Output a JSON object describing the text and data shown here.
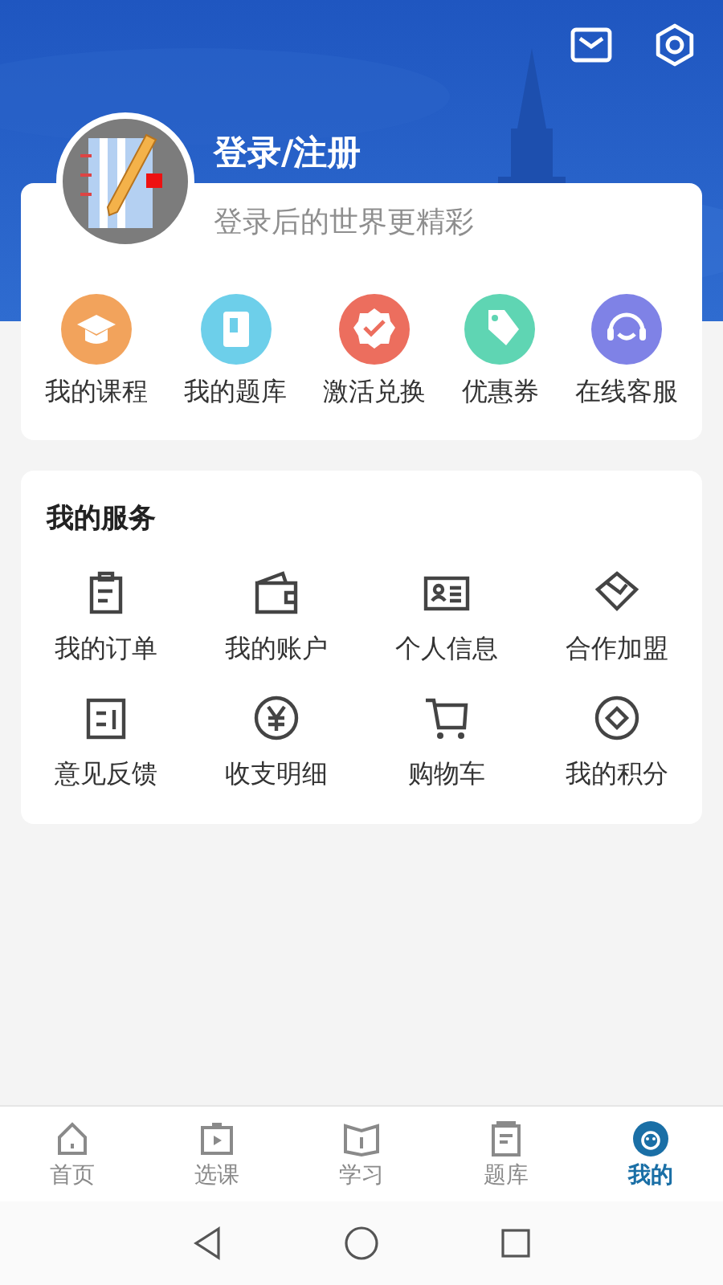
{
  "profile": {
    "title": "登录/注册",
    "subtitle": "登录后的世界更精彩"
  },
  "quick_actions": [
    {
      "label": "我的课程",
      "kind": "cap",
      "color": "#f2a35c"
    },
    {
      "label": "我的题库",
      "kind": "book",
      "color": "#6dcfea"
    },
    {
      "label": "激活兑换",
      "kind": "badge",
      "color": "#ec6e5e"
    },
    {
      "label": "优惠券",
      "kind": "tag",
      "color": "#5fd5b3"
    },
    {
      "label": "在线客服",
      "kind": "headset",
      "color": "#7f82e6"
    }
  ],
  "services": {
    "title": "我的服务",
    "items": [
      {
        "label": "我的订单",
        "kind": "order"
      },
      {
        "label": "我的账户",
        "kind": "wallet"
      },
      {
        "label": "个人信息",
        "kind": "idcard"
      },
      {
        "label": "合作加盟",
        "kind": "partner"
      },
      {
        "label": "意见反馈",
        "kind": "feedback"
      },
      {
        "label": "收支明细",
        "kind": "yuan"
      },
      {
        "label": "购物车",
        "kind": "cart"
      },
      {
        "label": "我的积分",
        "kind": "points"
      }
    ]
  },
  "tabs": [
    {
      "label": "首页",
      "kind": "home",
      "selected": false
    },
    {
      "label": "选课",
      "kind": "video",
      "selected": false
    },
    {
      "label": "学习",
      "kind": "book",
      "selected": false
    },
    {
      "label": "题库",
      "kind": "doc",
      "selected": false
    },
    {
      "label": "我的",
      "kind": "face",
      "selected": true
    }
  ]
}
